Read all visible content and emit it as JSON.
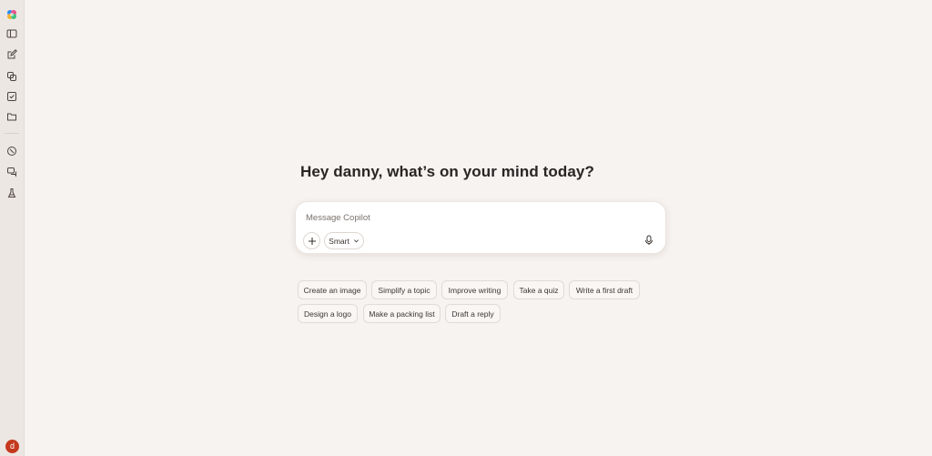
{
  "greeting": "Hey danny, what’s on your mind today?",
  "composer": {
    "placeholder": "Message Copilot",
    "mode_label": "Smart"
  },
  "suggestions": {
    "row1": [
      "Create an image",
      "Simplify a topic",
      "Improve writing",
      "Take a quiz",
      "Write a first draft"
    ],
    "row2": [
      "Design a logo",
      "Make a packing list",
      "Draft a reply"
    ]
  },
  "user": {
    "initial": "d"
  },
  "colors": {
    "background": "#f7f3f0",
    "sidebar": "#ede7e3",
    "avatar": "#c4391d"
  },
  "sidebar_icons": [
    "copilot-logo-icon",
    "sidebar-toggle-icon",
    "new-chat-icon",
    "library-icon",
    "tasks-icon",
    "folder-icon",
    "discover-icon",
    "chat-bubbles-icon",
    "labs-icon"
  ]
}
